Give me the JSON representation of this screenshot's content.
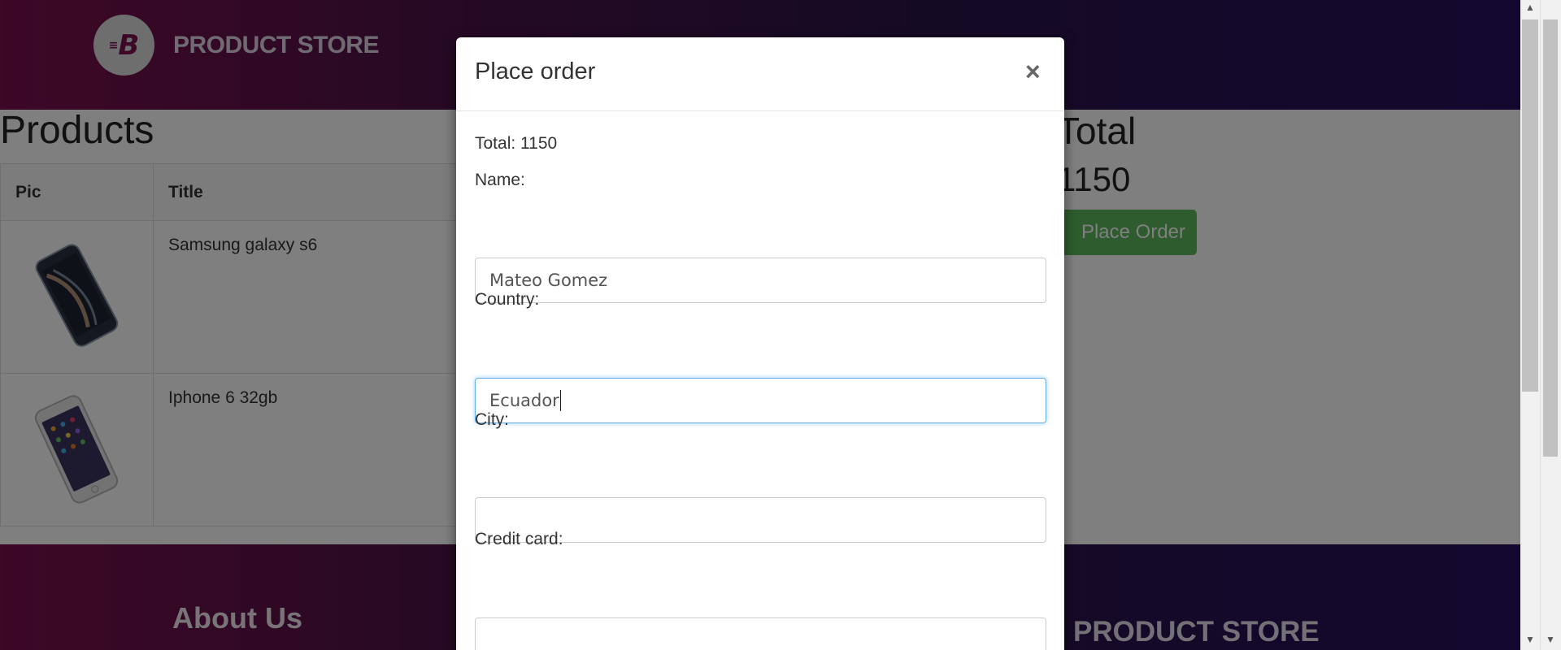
{
  "navbar": {
    "brand_initial": "B",
    "brand_name": "PRODUCT STORE"
  },
  "main": {
    "products_title": "Products",
    "table": {
      "headers": [
        "Pic",
        "Title"
      ],
      "rows": [
        {
          "title": "Samsung galaxy s6",
          "image_icon": "samsung-galaxy-s6-image"
        },
        {
          "title": "Iphone 6 32gb",
          "image_icon": "iphone-6-image"
        }
      ]
    },
    "total_title": "Total",
    "total_value": "1150",
    "place_order_label": "Place Order"
  },
  "footer": {
    "about": "About Us",
    "brand_name": "PRODUCT STORE"
  },
  "modal": {
    "title": "Place order",
    "close_label": "×",
    "total_line": "Total: 1150",
    "fields": [
      {
        "label": "Name:",
        "value": "Mateo Gomez"
      },
      {
        "label": "Country:",
        "value": "Ecuador"
      },
      {
        "label": "City:",
        "value": ""
      },
      {
        "label": "Credit card:",
        "value": ""
      }
    ]
  },
  "colors": {
    "nav_gradient_start": "#7a0f4c",
    "nav_gradient_end": "#270f5e",
    "success_button": "#5cb85c",
    "focus_border": "#66afe9"
  }
}
